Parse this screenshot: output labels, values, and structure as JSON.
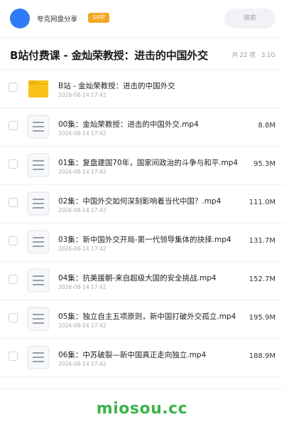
{
  "topbar": {
    "app_name": "夸克网盘分享",
    "badge": "SVIP",
    "search_placeholder": "搜索",
    "avatar_color": "#2f7bf5",
    "badge_color": "#f5a623"
  },
  "folder": {
    "title": "B站付费课 - 金灿荣教授：进击的中国外交",
    "meta": "共 22 项 · 3.1G"
  },
  "files": [
    {
      "icon": "folder-icon",
      "name": "B站 - 金灿荣教授：进击的中国外交",
      "date": "2026-08-14 17:42",
      "size": ""
    },
    {
      "icon": "file-icon",
      "name": "00集：金灿荣教授：进击的中国外交.mp4",
      "date": "2026-08-14 17:42",
      "size": "8.8M"
    },
    {
      "icon": "file-icon",
      "name": "01集：复盘建国70年，国家间政治的斗争与和平.mp4",
      "date": "2026-08-14 17:42",
      "size": "95.3M"
    },
    {
      "icon": "file-icon",
      "name": "02集：中国外交如何深刻影响着当代中国？.mp4",
      "date": "2026-08-14 17:42",
      "size": "111.0M"
    },
    {
      "icon": "file-icon",
      "name": "03集：新中国外交开局-第一代领导集体的抉择.mp4",
      "date": "2026-08-14 17:42",
      "size": "131.7M"
    },
    {
      "icon": "file-icon",
      "name": "04集：抗美援朝-来自超级大国的安全挑战.mp4",
      "date": "2026-08-14 17:42",
      "size": "152.7M"
    },
    {
      "icon": "file-icon",
      "name": "05集：独立自主五项原则，新中国打破外交孤立.mp4",
      "date": "2026-08-14 17:42",
      "size": "195.9M"
    },
    {
      "icon": "file-icon",
      "name": "06集：中苏破裂—新中国真正走向独立.mp4",
      "date": "2026-08-14 17:42",
      "size": "188.9M"
    }
  ],
  "watermark": "miosou.cc",
  "colors": {
    "watermark": "#3bb54a",
    "folder": "#f8c21a"
  }
}
